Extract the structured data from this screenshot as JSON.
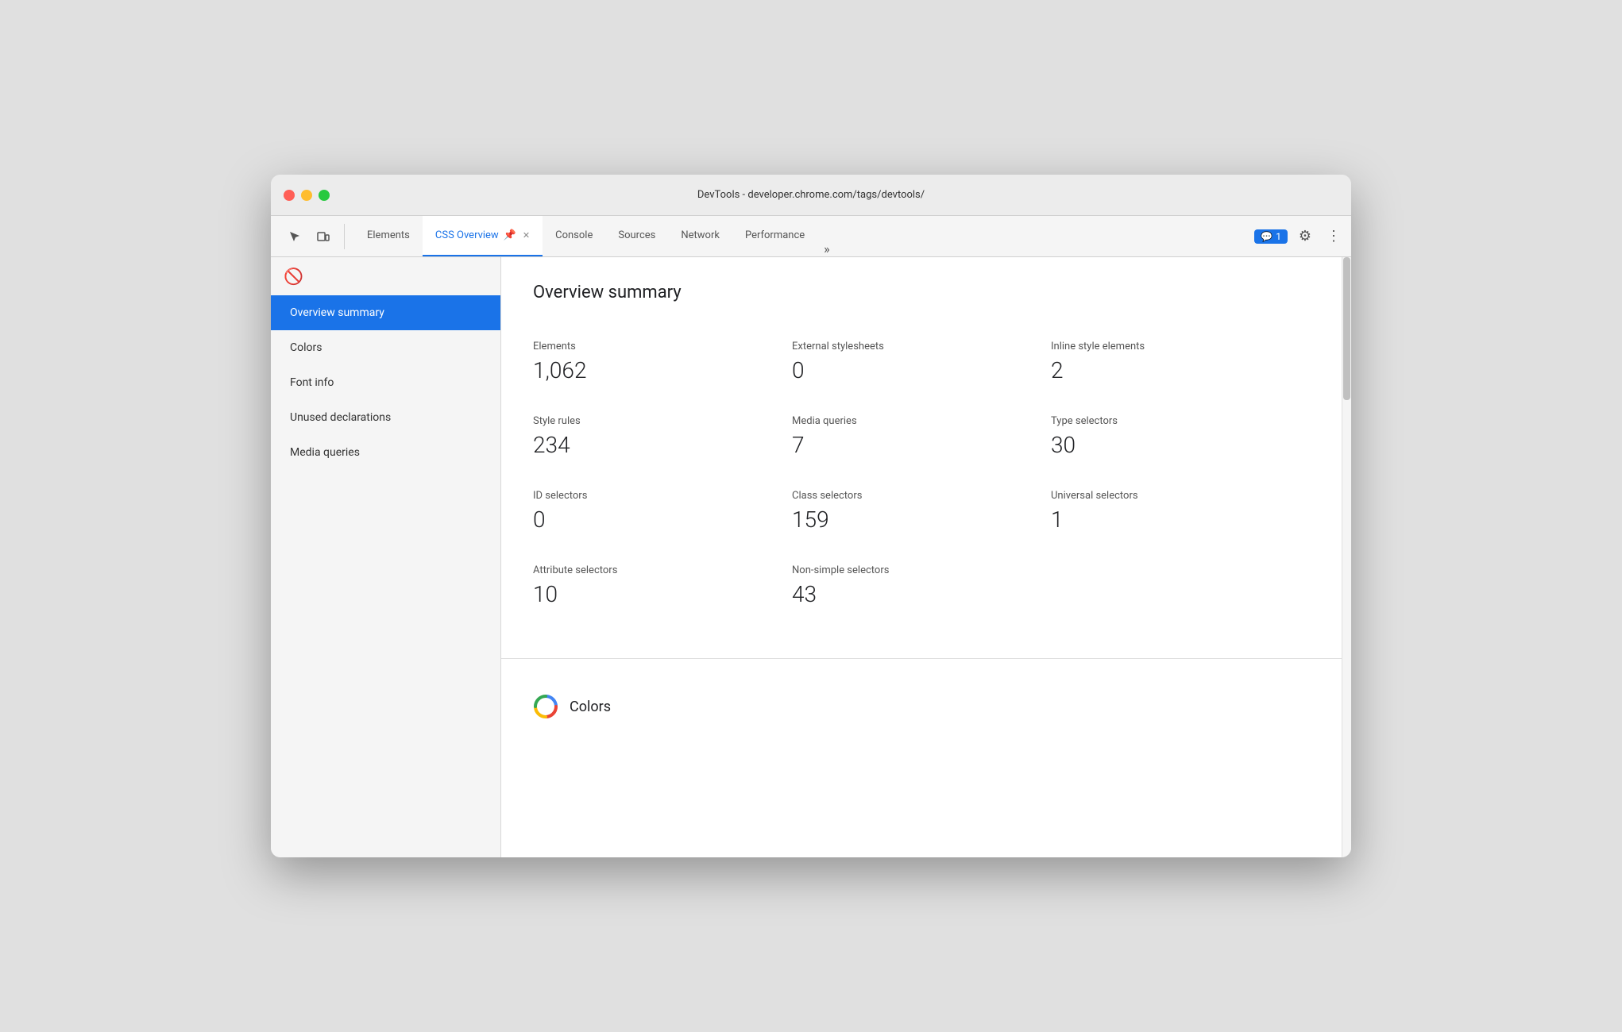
{
  "window": {
    "title": "DevTools - developer.chrome.com/tags/devtools/"
  },
  "tabs": [
    {
      "id": "elements",
      "label": "Elements",
      "active": false,
      "closable": false
    },
    {
      "id": "css-overview",
      "label": "CSS Overview",
      "active": true,
      "closable": true,
      "has_pin": true
    },
    {
      "id": "console",
      "label": "Console",
      "active": false,
      "closable": false
    },
    {
      "id": "sources",
      "label": "Sources",
      "active": false,
      "closable": false
    },
    {
      "id": "network",
      "label": "Network",
      "active": false,
      "closable": false
    },
    {
      "id": "performance",
      "label": "Performance",
      "active": false,
      "closable": false
    }
  ],
  "tab_more": "»",
  "chat_badge": {
    "icon": "💬",
    "count": "1"
  },
  "sidebar": {
    "items": [
      {
        "id": "overview-summary",
        "label": "Overview summary",
        "active": true
      },
      {
        "id": "colors",
        "label": "Colors",
        "active": false
      },
      {
        "id": "font-info",
        "label": "Font info",
        "active": false
      },
      {
        "id": "unused-declarations",
        "label": "Unused declarations",
        "active": false
      },
      {
        "id": "media-queries",
        "label": "Media queries",
        "active": false
      }
    ]
  },
  "main": {
    "title": "Overview summary",
    "stats": [
      {
        "id": "elements",
        "label": "Elements",
        "value": "1,062"
      },
      {
        "id": "external-stylesheets",
        "label": "External stylesheets",
        "value": "0"
      },
      {
        "id": "inline-style-elements",
        "label": "Inline style elements",
        "value": "2"
      },
      {
        "id": "style-rules",
        "label": "Style rules",
        "value": "234"
      },
      {
        "id": "media-queries",
        "label": "Media queries",
        "value": "7"
      },
      {
        "id": "type-selectors",
        "label": "Type selectors",
        "value": "30"
      },
      {
        "id": "id-selectors",
        "label": "ID selectors",
        "value": "0"
      },
      {
        "id": "class-selectors",
        "label": "Class selectors",
        "value": "159"
      },
      {
        "id": "universal-selectors",
        "label": "Universal selectors",
        "value": "1"
      },
      {
        "id": "attribute-selectors",
        "label": "Attribute selectors",
        "value": "10"
      },
      {
        "id": "non-simple-selectors",
        "label": "Non-simple selectors",
        "value": "43"
      }
    ],
    "colors_section_title": "Colors"
  },
  "colors": {
    "accent": "#1a73e8"
  }
}
